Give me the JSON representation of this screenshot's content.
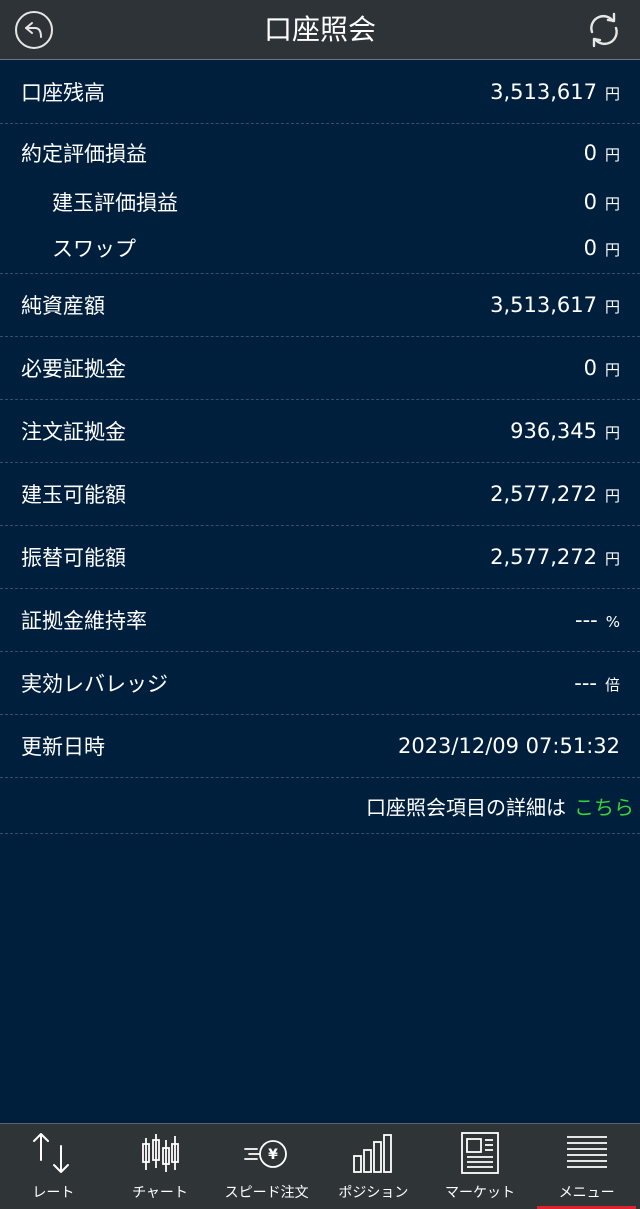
{
  "header": {
    "title": "口座照会",
    "back_icon": "back-arrow-icon",
    "refresh_icon": "refresh-icon"
  },
  "rows": [
    {
      "label": "口座残高",
      "value": "3,513,617",
      "unit": "円"
    },
    {
      "label": "約定評価損益",
      "value": "0",
      "unit": "円"
    },
    {
      "label": "建玉評価損益",
      "value": "0",
      "unit": "円"
    },
    {
      "label": "スワップ",
      "value": "0",
      "unit": "円"
    },
    {
      "label": "純資産額",
      "value": "3,513,617",
      "unit": "円"
    },
    {
      "label": "必要証拠金",
      "value": "0",
      "unit": "円"
    },
    {
      "label": "注文証拠金",
      "value": "936,345",
      "unit": "円"
    },
    {
      "label": "建玉可能額",
      "value": "2,577,272",
      "unit": "円"
    },
    {
      "label": "振替可能額",
      "value": "2,577,272",
      "unit": "円"
    },
    {
      "label": "証拠金維持率",
      "value": "---",
      "unit": "%"
    },
    {
      "label": "実効レバレッジ",
      "value": "---",
      "unit": "倍"
    },
    {
      "label": "更新日時",
      "value": "2023/12/09 07:51:32",
      "unit": ""
    }
  ],
  "detail": {
    "text": "口座照会項目の詳細は",
    "link": "こちら",
    "link_color": "#3ad23a"
  },
  "tabs": [
    {
      "label": "レート",
      "icon": "rate-arrows-icon"
    },
    {
      "label": "チャート",
      "icon": "candlestick-chart-icon"
    },
    {
      "label": "スピード注文",
      "icon": "speed-order-yen-icon"
    },
    {
      "label": "ポジション",
      "icon": "position-bars-icon"
    },
    {
      "label": "マーケット",
      "icon": "market-news-icon"
    },
    {
      "label": "メニュー",
      "icon": "menu-list-icon",
      "active": true
    }
  ],
  "colors": {
    "background": "#001f3d",
    "header": "#2d3337",
    "tabbar": "#2f3437",
    "active_indicator": "#e0222e"
  }
}
